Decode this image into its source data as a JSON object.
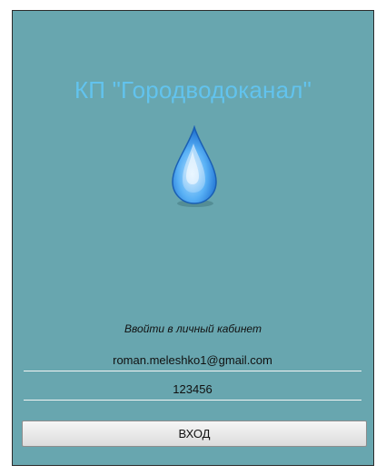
{
  "header": {
    "title": "КП \"Городводоканал\""
  },
  "logo": {
    "icon": "water-drop-icon",
    "color": "#4fa7f0"
  },
  "login": {
    "subtitle": "Ввойти в личный кабинет",
    "email_value": "roman.meleshko1@gmail.com",
    "password_value": "123456",
    "submit_label": "ВХОД"
  },
  "colors": {
    "panel_background": "#68a6af",
    "title": "#62c3ee"
  }
}
